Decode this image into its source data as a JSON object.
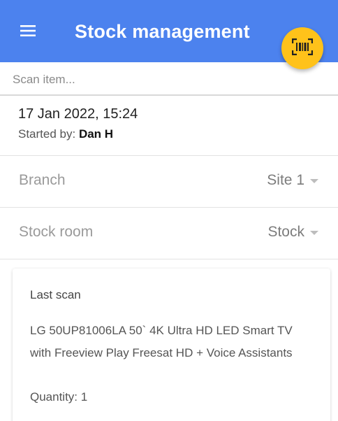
{
  "app_bar": {
    "title": "Stock management",
    "menu_icon": "hamburger-menu-icon",
    "scan_icon": "barcode-scanner-icon",
    "color": "#4c82ee",
    "fab_color": "#ffc21a"
  },
  "scan": {
    "placeholder": "Scan item...",
    "value": ""
  },
  "session": {
    "date": "17 Jan 2022, 15:24",
    "started_by_label": "Started by:",
    "started_by": "Dan H"
  },
  "branch": {
    "label": "Branch",
    "value": "Site 1"
  },
  "stock_room": {
    "label": "Stock room",
    "value": "Stock"
  },
  "last_scan": {
    "title": "Last scan",
    "product": "LG 50UP81006LA 50` 4K Ultra HD LED Smart TV with Freeview Play Freesat HD + Voice Assistants",
    "quantity_label": "Quantity: 1"
  }
}
